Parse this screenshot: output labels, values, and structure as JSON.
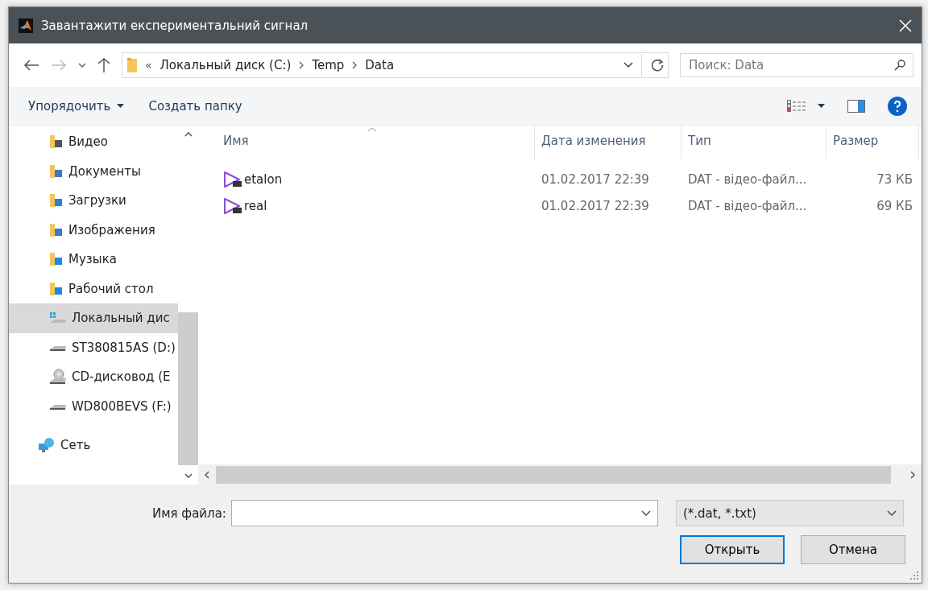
{
  "window": {
    "title": "Завантажити експериментальний сигнал"
  },
  "nav": {
    "path_prefix": "«",
    "path": [
      "Локальный диск (C:)",
      "Temp",
      "Data"
    ],
    "search": {
      "placeholder": "Поиск: Data"
    }
  },
  "toolbar": {
    "organize": "Упорядочить",
    "new_folder": "Создать папку"
  },
  "sidebar": {
    "items": [
      {
        "kind": "video",
        "label": "Видео",
        "selected": false
      },
      {
        "kind": "documents",
        "label": "Документы",
        "selected": false
      },
      {
        "kind": "downloads",
        "label": "Загрузки",
        "selected": false
      },
      {
        "kind": "images",
        "label": "Изображения",
        "selected": false
      },
      {
        "kind": "music",
        "label": "Музыка",
        "selected": false
      },
      {
        "kind": "desktop",
        "label": "Рабочий стол",
        "selected": false
      },
      {
        "kind": "system_drive",
        "label": "Локальный дис",
        "selected": true
      },
      {
        "kind": "drive",
        "label": "ST380815AS (D:)",
        "selected": false
      },
      {
        "kind": "cd",
        "label": "CD-дисковод (E",
        "selected": false
      },
      {
        "kind": "drive",
        "label": "WD800BEVS (F:)",
        "selected": false
      },
      {
        "kind": "network",
        "label": "Сеть",
        "selected": false
      }
    ]
  },
  "table": {
    "columns": [
      "Имя",
      "Дата изменения",
      "Тип",
      "Размер"
    ],
    "rows": [
      {
        "name": "etalon",
        "date": "01.02.2017 22:39",
        "type": "DAT - відео-файл...",
        "size": "73 КБ",
        "selected": false
      },
      {
        "name": "real",
        "date": "01.02.2017 22:39",
        "type": "DAT - відео-файл...",
        "size": "69 КБ",
        "selected": false
      }
    ]
  },
  "footer": {
    "file_name_label": "Имя файла:",
    "filter": "(*.dat, *.txt)",
    "open": "Открыть",
    "cancel": "Отмена"
  }
}
